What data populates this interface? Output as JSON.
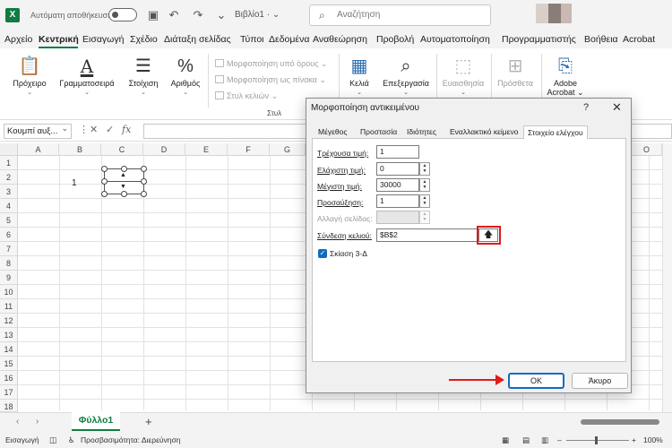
{
  "titlebar": {
    "autosave_label": "Αυτόματη αποθήκευση",
    "filename": "Βιβλίο1  ·  ⌄",
    "search_placeholder": "Αναζήτηση"
  },
  "menu": [
    "Αρχείο",
    "Κεντρική",
    "Εισαγωγή",
    "Σχέδιο",
    "Διάταξη σελίδας",
    "Τύποι",
    "Δεδομένα",
    "Αναθεώρηση",
    "Προβολή",
    "Αυτοματοποίηση",
    "Προγραμματιστής",
    "Βοήθεια",
    "Acrobat"
  ],
  "ribbon": {
    "clipboard": "Πρόχειρο",
    "font": "Γραμματοσειρά",
    "alignment": "Στοίχιση",
    "number": "Αριθμός",
    "conditional": "Μορφοποίηση υπό όρους",
    "format_table": "Μορφοποίηση ως πίνακα",
    "cell_styles": "Στυλ κελιών",
    "styles_group": "Στυλ",
    "cells": "Κελιά",
    "editing": "Επεξεργασία",
    "sensitivity": "Ευαισθησία",
    "addins": "Πρόσθετα",
    "acrobat_1": "Adobe",
    "acrobat_2": "Acrobat"
  },
  "formulabar": {
    "namebox": "Κουμπί αυξ..."
  },
  "grid": {
    "columns": [
      "A",
      "B",
      "C",
      "D",
      "E",
      "F",
      "G",
      "H",
      "I",
      "J",
      "K",
      "L",
      "M",
      "N",
      "O"
    ],
    "rows": [
      "1",
      "2",
      "3",
      "4",
      "5",
      "6",
      "7",
      "8",
      "9",
      "10",
      "11",
      "12",
      "13",
      "14",
      "15",
      "16",
      "17",
      "18"
    ],
    "b2": "1"
  },
  "sheets": {
    "active": "Φύλλο1"
  },
  "status": {
    "mode": "Εισαγωγή",
    "accessibility": "Προσβασιμότητα: Διερεύνηση",
    "zoom": "100%"
  },
  "dialog": {
    "title": "Μορφοποίηση αντικειμένου",
    "help": "?",
    "tabs": [
      "Μέγεθος",
      "Προστασία",
      "Ιδιότητες",
      "Εναλλακτικό κείμενο",
      "Στοιχείο ελέγχου"
    ],
    "current_label": "Τρέχουσα τιμή:",
    "current_value": "1",
    "min_label": "Ελάχιστη τιμή:",
    "min_value": "0",
    "max_label": "Μέγιστη τιμή:",
    "max_value": "30000",
    "incr_label": "Προσαύξηση:",
    "incr_value": "1",
    "page_label": "Αλλαγή σελίδας:",
    "link_label": "Σύνδεση κελιού:",
    "link_value": "$B$2",
    "shading_label": "Σκίαση 3-Δ",
    "ok": "OK",
    "cancel": "Άκυρο"
  },
  "colors": {
    "excel_green": "#107c41",
    "accent_blue": "#0f6cbd",
    "annotation_red": "#e01a1a"
  }
}
